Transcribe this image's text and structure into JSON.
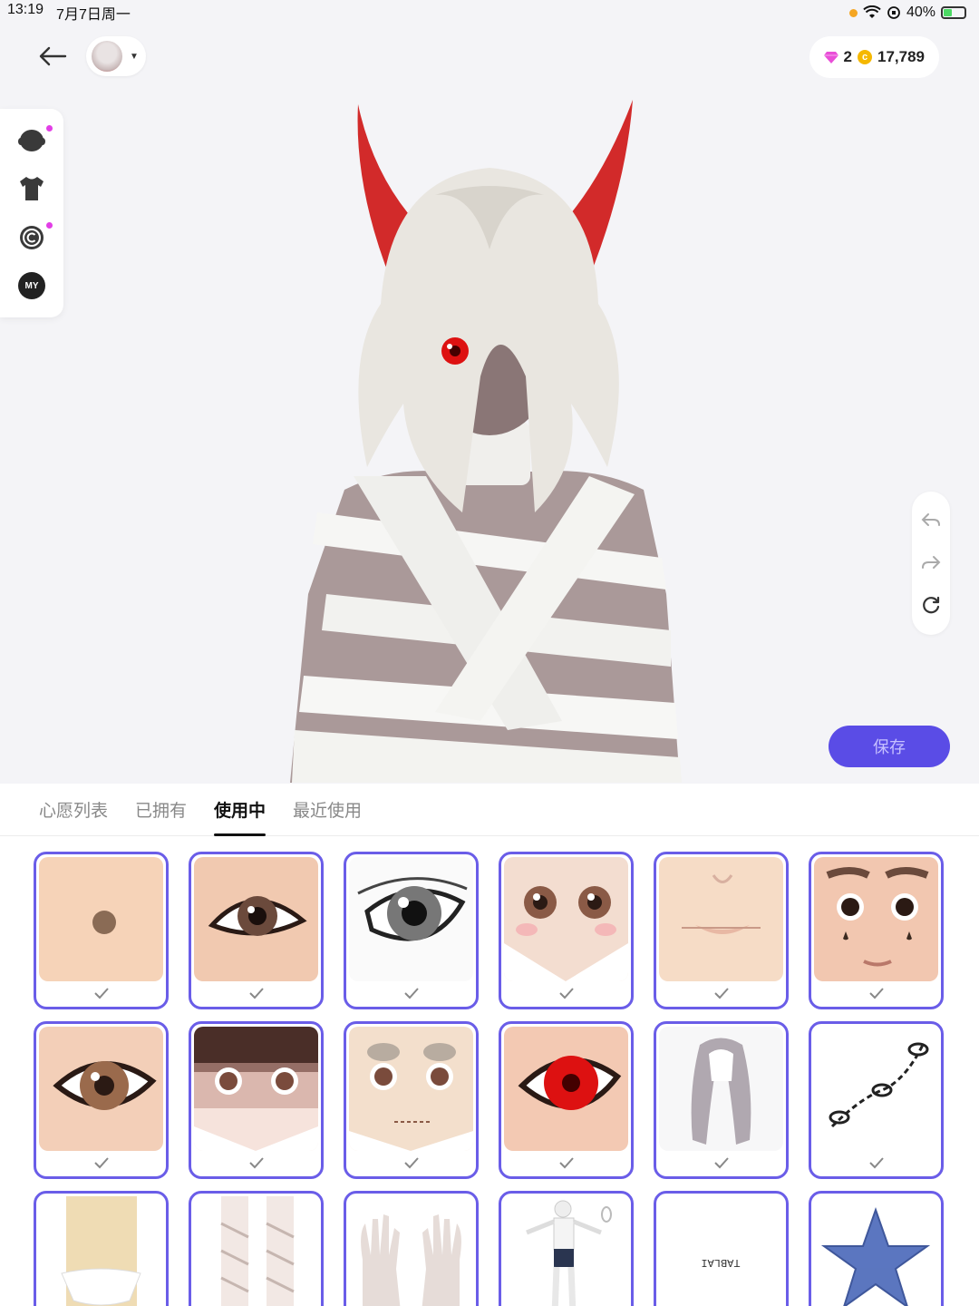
{
  "status_bar": {
    "time": "13:19",
    "date": "7月7日周一",
    "battery_percent": "40%",
    "battery_level": 0.4
  },
  "header": {
    "gems": "2",
    "coins": "17,789"
  },
  "side_toolbar": {
    "items": [
      {
        "icon": "head-icon",
        "has_dot": true
      },
      {
        "icon": "shirt-icon",
        "has_dot": false
      },
      {
        "icon": "copyright-icon",
        "has_dot": true
      },
      {
        "icon": "my-icon",
        "label": "MY",
        "has_dot": false
      }
    ]
  },
  "history": {
    "undo_icon": "undo-icon",
    "redo_icon": "redo-icon",
    "reset_icon": "reset-icon"
  },
  "save_label": "保存",
  "tabs": [
    {
      "label": "心愿列表",
      "active": false
    },
    {
      "label": "已拥有",
      "active": false
    },
    {
      "label": "使用中",
      "active": true
    },
    {
      "label": "最近使用",
      "active": false
    }
  ],
  "items": [
    {
      "name": "mole-item",
      "kind": "mole"
    },
    {
      "name": "eye-makeup-item",
      "kind": "eye-brown"
    },
    {
      "name": "gray-eye-item",
      "kind": "eye-gray"
    },
    {
      "name": "anime-face-item",
      "kind": "face-anime"
    },
    {
      "name": "lips-item",
      "kind": "lips"
    },
    {
      "name": "tear-face-item",
      "kind": "face-tears"
    },
    {
      "name": "brown-eye-item",
      "kind": "eye-brown2"
    },
    {
      "name": "dark-eye-face-item",
      "kind": "face-dark"
    },
    {
      "name": "stitched-face-item",
      "kind": "face-stitch"
    },
    {
      "name": "red-eye-item",
      "kind": "eye-red"
    },
    {
      "name": "silver-hair-item",
      "kind": "hair"
    },
    {
      "name": "chain-tattoo-item",
      "kind": "tattoo"
    },
    {
      "name": "underwear-item",
      "kind": "underwear"
    },
    {
      "name": "leg-bandage-item",
      "kind": "bandage"
    },
    {
      "name": "hands-item",
      "kind": "hands"
    },
    {
      "name": "body-item",
      "kind": "body"
    },
    {
      "name": "text-tattoo-item",
      "kind": "text",
      "text": "TABLAI"
    },
    {
      "name": "star-item",
      "kind": "star"
    }
  ],
  "colors": {
    "accent": "#5a4ce6",
    "card_border": "#6a5de8",
    "dot": "#e23ee6"
  }
}
